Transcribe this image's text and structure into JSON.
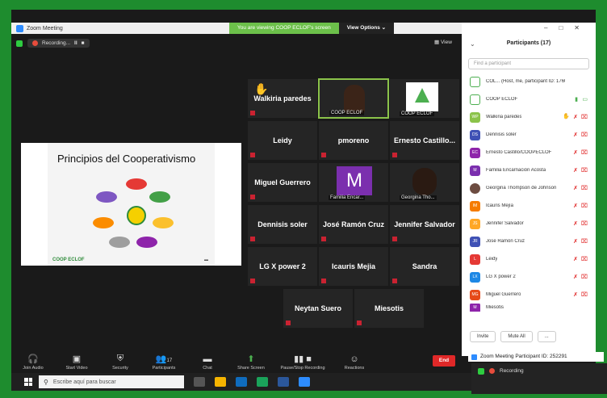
{
  "window": {
    "title": "Zoom Meeting"
  },
  "share_banner": {
    "text": "You are viewing COOP ECLOF's screen",
    "view_options": "View Options ⌄"
  },
  "recording": {
    "label": "Recording...",
    "pause": "II",
    "stop": "■"
  },
  "view_button": "▦ View",
  "slide": {
    "title": "Principios del Cooperativismo",
    "logo_text": "COOP ECLOF"
  },
  "tiles": [
    {
      "name": "Walkiria paredes"
    },
    {
      "name": "COOP ECLOF",
      "caption": "COOP ECLOF"
    },
    {
      "name": "COOP ECLOF",
      "caption": "COOP ECLOF"
    },
    {
      "name": "Leidy"
    },
    {
      "name": "pmoreno"
    },
    {
      "name": "Ernesto Castillo..."
    },
    {
      "name": "Miguel Guerrero"
    },
    {
      "name": "Familia Encar...",
      "initial": "M"
    },
    {
      "name": "Georgina Tho..."
    },
    {
      "name": "Dennisis soler"
    },
    {
      "name": "José Ramón Cruz"
    },
    {
      "name": "Jennifer Salvador"
    },
    {
      "name": "LG X power 2"
    },
    {
      "name": "Icauris Mejia"
    },
    {
      "name": "Sandra"
    },
    {
      "name": "Neytan Suero"
    },
    {
      "name": "Miesotis"
    }
  ],
  "toolbar": {
    "join_audio": "Join Audio",
    "start_video": "Start Video",
    "security": "Security",
    "participants": "Participants",
    "participants_count": "17",
    "chat": "Chat",
    "share_screen": "Share Screen",
    "pause_stop_recording": "Pause/Stop Recording",
    "reactions": "Reactions",
    "end": "End"
  },
  "taskbar": {
    "search_placeholder": "Escribe aquí para buscar"
  },
  "participants_panel": {
    "title": "Participants (17)",
    "find_placeholder": "Find a participant",
    "rows": [
      {
        "initials": "",
        "name": "COL... (Host, me, participant ID: 176000)",
        "color": "#ffffff"
      },
      {
        "initials": "",
        "name": "COOP ECLOF",
        "color": "#ffffff"
      },
      {
        "initials": "WP",
        "name": "Walkiria paredes",
        "color": "#8bc34a"
      },
      {
        "initials": "DS",
        "name": "Dennisis soler",
        "color": "#3f51b5"
      },
      {
        "initials": "EC",
        "name": "Ernesto Castillo/COOPECLOF",
        "color": "#8e24aa"
      },
      {
        "initials": "M",
        "name": "Familia Encarnación Acosta",
        "color": "#7b2fae"
      },
      {
        "initials": "",
        "name": "Georgina Thompson de Johnson",
        "color": "#6d4c41"
      },
      {
        "initials": "IM",
        "name": "Icauris Mejía",
        "color": "#f57c00"
      },
      {
        "initials": "JS",
        "name": "Jennifer Salvador",
        "color": "#ffa726"
      },
      {
        "initials": "JR",
        "name": "José Ramón Cruz",
        "color": "#3f51b5"
      },
      {
        "initials": "L",
        "name": "Leidy",
        "color": "#e53935"
      },
      {
        "initials": "LX",
        "name": "LG X power 2",
        "color": "#1e88e5"
      },
      {
        "initials": "MG",
        "name": "Miguel Guerrero",
        "color": "#e64a19"
      },
      {
        "initials": "M",
        "name": "Miesotis",
        "color": "#8e24aa"
      }
    ],
    "invite": "Invite",
    "mute_all": "Mute All",
    "more": "..."
  },
  "meeting_id": {
    "text": "Zoom Meeting Participant ID: 252291"
  },
  "float_recording": {
    "label": "Recording"
  },
  "colors": {
    "accent_green": "#1e8c2e",
    "zoom_blue": "#2d8cff",
    "end_red": "#e02828"
  }
}
